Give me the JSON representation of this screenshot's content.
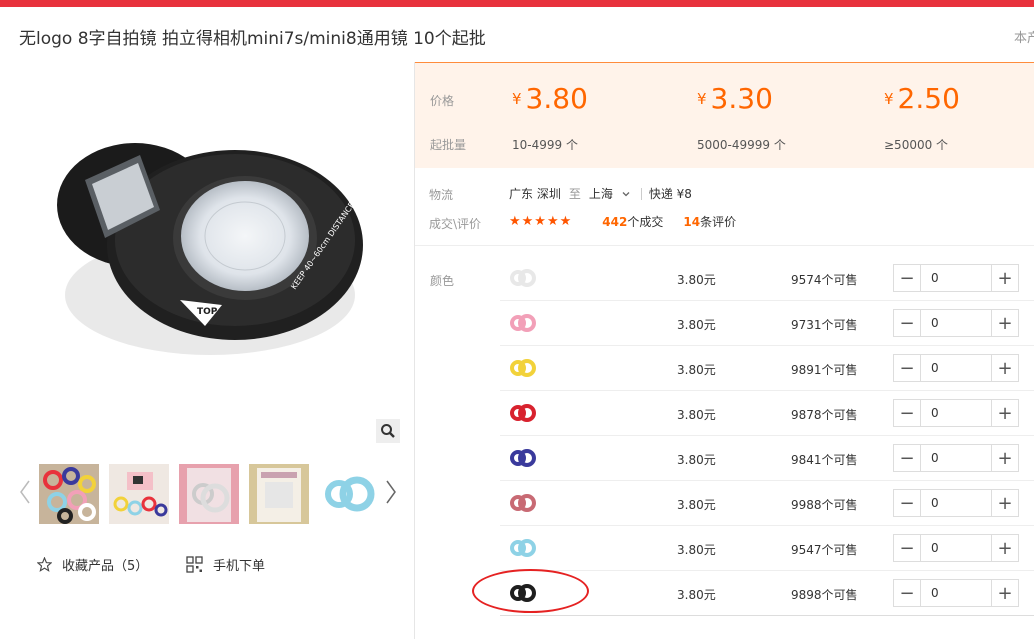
{
  "header": {
    "title": "无logo 8字自拍镜 拍立得相机mini7s/mini8通用镜 10个起批",
    "side_text": "本产"
  },
  "gallery": {
    "main_image_label": "KEEP 40~60cm DISTANCE",
    "main_image_top": "TOP",
    "thumb_count": 5
  },
  "actions": {
    "favorite": "收藏产品（5）",
    "mobile_order": "手机下单"
  },
  "price_box": {
    "price_label": "价格",
    "moq_label": "起批量",
    "currency": "¥",
    "tiers": [
      {
        "price": "3.80",
        "range": "10-4999 个"
      },
      {
        "price": "3.30",
        "range": "5000-49999 个"
      },
      {
        "price": "2.50",
        "range": "≥50000 个"
      }
    ]
  },
  "shipping": {
    "label": "物流",
    "from": "广东 深圳",
    "to_word": "至",
    "to": "上海",
    "express": "快递 ¥8"
  },
  "rating": {
    "label": "成交\\评价",
    "stars": "★★★★★",
    "deals_count": "442",
    "deals_text": "个成交",
    "reviews_count": "14",
    "reviews_text": "条评价"
  },
  "sku": {
    "label": "颜色",
    "rows": [
      {
        "color": "#e8e8e8",
        "price": "3.80元",
        "stock": "9574个可售",
        "qty": "0"
      },
      {
        "color": "#f2a0b8",
        "price": "3.80元",
        "stock": "9731个可售",
        "qty": "0"
      },
      {
        "color": "#f2d23a",
        "price": "3.80元",
        "stock": "9891个可售",
        "qty": "0"
      },
      {
        "color": "#d8222e",
        "price": "3.80元",
        "stock": "9878个可售",
        "qty": "0"
      },
      {
        "color": "#3a3a9c",
        "price": "3.80元",
        "stock": "9841个可售",
        "qty": "0"
      },
      {
        "color": "#c86a74",
        "price": "3.80元",
        "stock": "9988个可售",
        "qty": "0"
      },
      {
        "color": "#8ed2e6",
        "price": "3.80元",
        "stock": "9547个可售",
        "qty": "0"
      },
      {
        "color": "#1e1e1e",
        "price": "3.80元",
        "stock": "9898个可售",
        "qty": "0"
      }
    ]
  },
  "colors": {
    "accent_orange": "#ff6600",
    "top_bar": "#e8323c",
    "price_bg": "#fff3ea",
    "annotation": "#e52222"
  }
}
